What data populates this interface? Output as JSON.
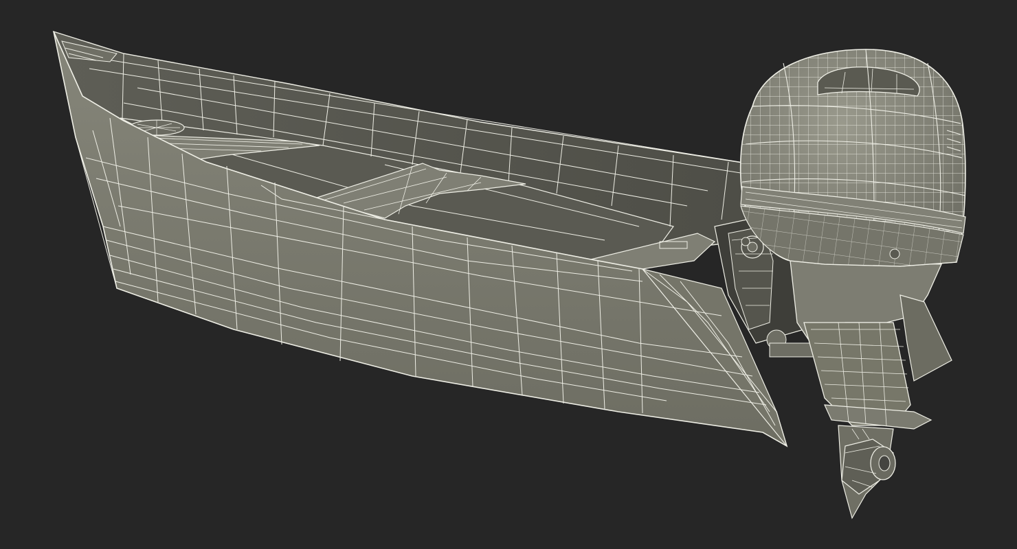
{
  "scene": {
    "subject": "aluminum-boat-with-outboard-motor",
    "render_style": "wireframe-over-shaded",
    "colors": {
      "background": "#262626",
      "hull_outer": "#7b7b6f",
      "hull_inner": "#56564f",
      "hull_dark": "#474740",
      "motor": "#8a8a7e",
      "motor_dark": "#5f5f56",
      "wire": "#efefe6"
    }
  }
}
